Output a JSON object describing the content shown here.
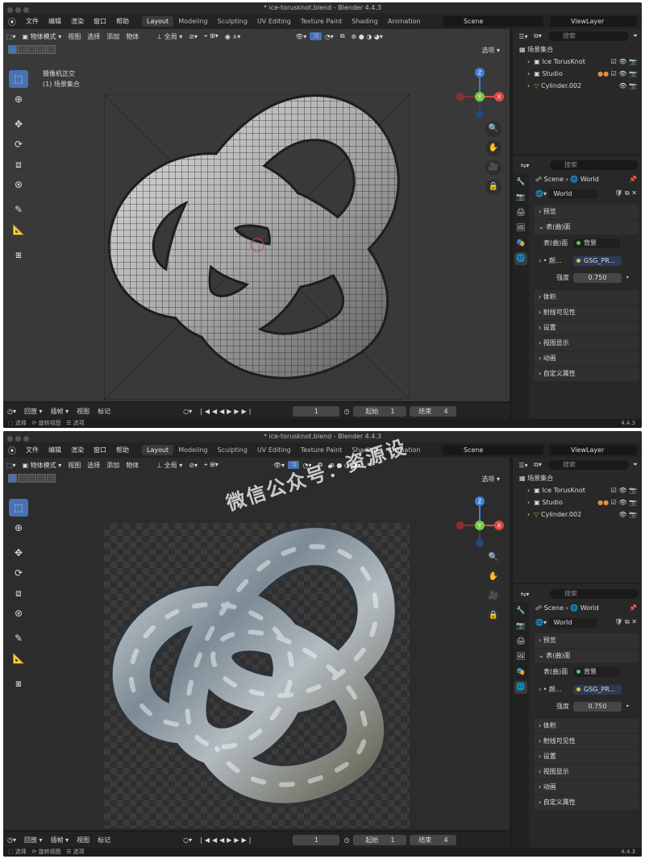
{
  "app": {
    "window_title": "* ice-torusknot.blend - Blender 4.4.3",
    "menus": [
      "文件",
      "编辑",
      "渲染",
      "窗口",
      "帮助"
    ],
    "workspaces": [
      "Layout",
      "Modeling",
      "Sculpting",
      "UV Editing",
      "Texture Paint",
      "Shading",
      "Animation"
    ],
    "active_workspace": "Layout",
    "scene": "Scene",
    "view_layer": "ViewLayer"
  },
  "viewport": {
    "mode": "物体模式",
    "header_menus": [
      "视图",
      "选择",
      "添加",
      "物体"
    ],
    "transform_orientation": "全局",
    "options_label": "选项",
    "camera_view_label": "摄像机正交",
    "collection_label": "(1) 场景集合",
    "gizmo_axes": [
      "X",
      "Y",
      "Z"
    ]
  },
  "timeline": {
    "playback": "回放",
    "keying": "插帧",
    "view": "视图",
    "marker": "标记",
    "current_frame": "1",
    "start_label": "起始",
    "start": "1",
    "end_label": "结束",
    "end": "4"
  },
  "status": {
    "left1": "选择",
    "left2": "旋转视图",
    "left3": "选项",
    "version": "4.4.3"
  },
  "outliner": {
    "search_placeholder": "搜索",
    "root": "场景集合",
    "items": [
      "Ice TorusKnot",
      "Studio",
      "Cylinder.002"
    ]
  },
  "properties": {
    "search_placeholder": "搜索",
    "breadcrumb_scene": "Scene",
    "breadcrumb_world": "World",
    "world_name": "World",
    "sections": {
      "preview": "预览",
      "surface": "表(曲)面",
      "surface_label": "表(曲)面",
      "surface_value": "背景",
      "color_label": "颜...",
      "color_value": "GSG_PR...",
      "strength_label": "强度",
      "strength_value": "0.750",
      "volume": "体积",
      "ray_visibility": "射线可见性",
      "settings": "设置",
      "viewport_display": "视图显示",
      "animation": "动画",
      "custom_props": "自定义属性"
    }
  },
  "watermark": "微信公众号：资源设",
  "colors": {
    "accent": "#4772b3",
    "axis_x": "#e04848",
    "axis_y": "#7ac943",
    "axis_z": "#3d7fd9",
    "ui_bg": "#1d1d1d"
  }
}
